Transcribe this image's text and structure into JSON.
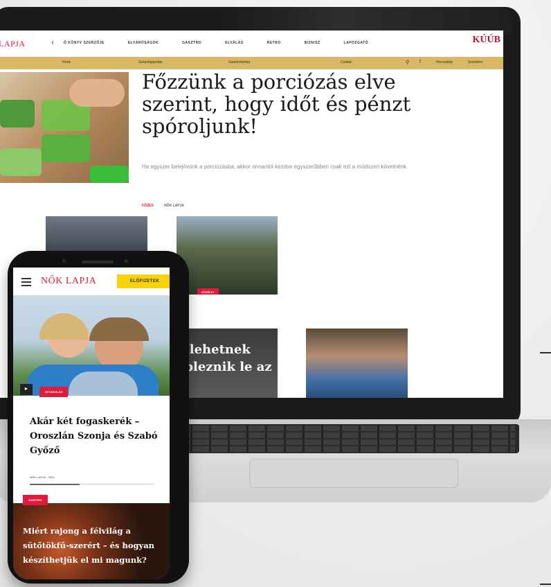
{
  "laptop": {
    "logo": "LAPJA",
    "nav_chevron": "‹",
    "nav_items": [
      "Ő KÖNYV SZERZŐJE",
      "ELVÁRÓSÁGOK",
      "GASZTRO",
      "ELVÁLÁS",
      "RETRO",
      "BIZNISZ",
      "LAPOZGATÓ"
    ],
    "brand_logo": "KÚÚB",
    "sub_nav": [
      "Hírek",
      "Szépségápolás",
      "Gasztronómia",
      "Család",
      "Horoszkóp",
      "Szerelem"
    ],
    "search_icon": "search-icon",
    "facebook_icon": "facebook-icon",
    "hero": {
      "title": "Főzzünk a porciózás elve szerint, hogy időt és pénzt spóroljunk!",
      "lead": "Ha egyszer belejövünk a porciózásba, akkor onnantól kezdve egyszerűbben csak ezt a módszert követnénk.",
      "category": "FŐZÉS",
      "brand": "NŐK LAPJA"
    },
    "card_tag": "KÖZÉLET",
    "dark_card_text": "k lehetnek epleznik le az"
  },
  "phone": {
    "logo": "NŐK LAPJA",
    "subscribe_label": "ELŐFIZETEK",
    "photo_tag": "SZTÁRVILÁG",
    "headline": "Akár két fogaskerék – Oroszlán Szonja és Szabó Győző",
    "meta": "NŐK LAPJA · 2021",
    "food_tag": "GASZTRO",
    "food_title": "Miért rajong a félvilág a sütőtökfű-szerért – és hogyan készíthetjük el mi magunk?"
  },
  "colors": {
    "accent_red": "#e21a3b",
    "gold_subnav": "#d8b765",
    "subscribe_yellow": "#f6d20a"
  }
}
